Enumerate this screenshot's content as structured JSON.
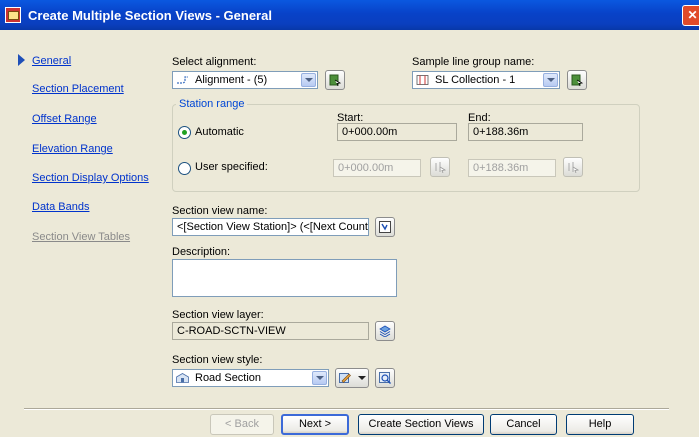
{
  "window": {
    "title": "Create Multiple Section Views - General",
    "close_glyph": "✕"
  },
  "nav": {
    "items": [
      {
        "label": "General",
        "active": true
      },
      {
        "label": "Section Placement"
      },
      {
        "label": "Offset Range"
      },
      {
        "label": "Elevation Range"
      },
      {
        "label": "Section Display Options"
      },
      {
        "label": "Data Bands"
      },
      {
        "label": "Section View Tables",
        "disabled": true
      }
    ]
  },
  "alignment": {
    "label": "Select alignment:",
    "value": "Alignment - (5)",
    "icon": "alignment-icon"
  },
  "sample_line_group": {
    "label": "Sample line group name:",
    "value": "SL Collection - 1",
    "icon": "sample-line-icon"
  },
  "station_range": {
    "title": "Station range",
    "start_label": "Start:",
    "end_label": "End:",
    "automatic_label": "Automatic",
    "user_specified_label": "User specified:",
    "selected": "automatic",
    "auto_start": "0+000.00m",
    "auto_end": "0+188.36m",
    "user_start": "0+000.00m",
    "user_end": "0+188.36m"
  },
  "section_view_name": {
    "label": "Section view name:",
    "value": "<[Section View Station]> (<[Next Counter(C"
  },
  "description": {
    "label": "Description:",
    "value": ""
  },
  "section_view_layer": {
    "label": "Section view layer:",
    "value": "C-ROAD-SCTN-VIEW"
  },
  "section_view_style": {
    "label": "Section view style:",
    "value": "Road Section",
    "icon": "section-style-icon"
  },
  "buttons": {
    "back": "< Back",
    "next": "Next >",
    "create": "Create Section Views",
    "cancel": "Cancel",
    "help": "Help"
  },
  "colors": {
    "title_bar": "#0a4fd6",
    "link": "#0033cc",
    "group_title": "#0046d5"
  }
}
